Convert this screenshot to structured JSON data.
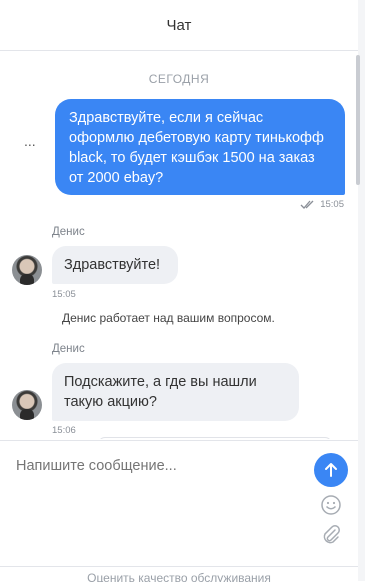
{
  "header": {
    "title": "Чат"
  },
  "chat": {
    "date_separator": "СЕГОДНЯ",
    "menu_ellipsis": "...",
    "outgoing": {
      "text": "Здравствуйте, если я сейчас оформлю дебетовую карту тинькофф black, то будет кэшбэк 1500 на заказ от 2000 ebay?",
      "time": "15:05",
      "status_icon": "double-check-icon"
    },
    "incoming": [
      {
        "sender": "Денис",
        "text": "Здравствуйте!",
        "time": "15:05"
      },
      {
        "sender": "Денис",
        "text": "Подскажите, а где вы нашли такую акцию?",
        "time": "15:06"
      }
    ],
    "system_message": "Денис работает над вашим вопросом."
  },
  "composer": {
    "placeholder": "Напишите сообщение...",
    "send_icon": "arrow-up-icon",
    "emoji_icon": "smiley-icon",
    "attach_icon": "paperclip-icon"
  },
  "footer": {
    "rate_label": "Оценить качество обслуживания"
  },
  "colors": {
    "accent": "#3a86f4",
    "bubble_in": "#eef0f4",
    "muted": "#9aa0a8"
  }
}
